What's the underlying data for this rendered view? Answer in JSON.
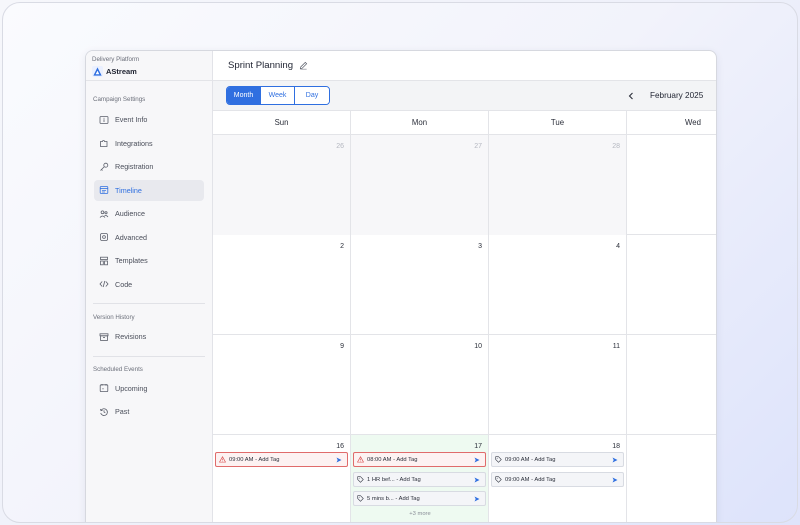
{
  "sidebar": {
    "platform_label": "Delivery Platform",
    "app_name": "AStream",
    "sections": [
      {
        "title": "Campaign Settings",
        "items": [
          {
            "label": "Event Info",
            "icon": "info-icon"
          },
          {
            "label": "Integrations",
            "icon": "puzzle-icon"
          },
          {
            "label": "Registration",
            "icon": "key-icon"
          },
          {
            "label": "Timeline",
            "icon": "calendar-list-icon",
            "active": true
          },
          {
            "label": "Audience",
            "icon": "users-icon"
          },
          {
            "label": "Advanced",
            "icon": "gear-icon"
          },
          {
            "label": "Templates",
            "icon": "layout-icon"
          },
          {
            "label": "Code",
            "icon": "code-icon"
          }
        ]
      },
      {
        "title": "Version History",
        "items": [
          {
            "label": "Revisions",
            "icon": "archive-icon"
          }
        ]
      },
      {
        "title": "Scheduled Events",
        "items": [
          {
            "label": "Upcoming",
            "icon": "calendar-icon"
          },
          {
            "label": "Past",
            "icon": "history-icon"
          }
        ]
      }
    ]
  },
  "header": {
    "title": "Sprint Planning"
  },
  "toolbar": {
    "views": [
      "Month",
      "Week",
      "Day"
    ],
    "active_view": "Month",
    "month_label": "February 2025"
  },
  "calendar": {
    "weekdays": [
      "Sun",
      "Mon",
      "Tue",
      "Wed"
    ],
    "weeks": [
      [
        "26",
        "27",
        "28",
        ""
      ],
      [
        "2",
        "3",
        "4",
        ""
      ],
      [
        "9",
        "10",
        "11",
        ""
      ],
      [
        "16",
        "17",
        "18",
        ""
      ]
    ],
    "events": {
      "sun16": [
        {
          "text": "09:00 AM  - Add Tag",
          "type": "alert"
        }
      ],
      "mon17": [
        {
          "text": "08:00 AM  - Add Tag",
          "type": "alert"
        },
        {
          "text": "1 HR bef...  - Add Tag",
          "type": "tag"
        },
        {
          "text": "5 mins b...  - Add Tag",
          "type": "tag"
        }
      ],
      "tue18": [
        {
          "text": "09:00 AM  - Add Tag",
          "type": "tag"
        },
        {
          "text": "09:00 AM  - Add Tag",
          "type": "tag"
        }
      ]
    },
    "more_label": "+3 more"
  },
  "colors": {
    "accent": "#2f6fe0",
    "alert": "#e06b6b",
    "today_bg": "#eefaf1"
  }
}
